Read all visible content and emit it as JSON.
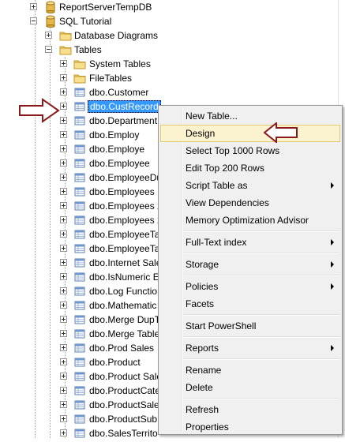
{
  "tree": {
    "nodes": [
      {
        "label": "ReportServerTempDB",
        "icon": "database-icon",
        "expanded": false
      },
      {
        "label": "SQL Tutorial",
        "icon": "database-icon",
        "expanded": true
      },
      {
        "label": "Database Diagrams",
        "icon": "folder-icon",
        "expanded": false
      },
      {
        "label": "Tables",
        "icon": "folder-icon",
        "expanded": true
      },
      {
        "label": "System Tables",
        "icon": "folder-icon",
        "expanded": false
      },
      {
        "label": "FileTables",
        "icon": "folder-icon",
        "expanded": false
      },
      {
        "label": "dbo.Customer",
        "icon": "table-icon",
        "expanded": false
      },
      {
        "label": "dbo.CustRecord",
        "icon": "table-icon",
        "expanded": false,
        "selected": true
      },
      {
        "label": "dbo.Department",
        "icon": "table-icon",
        "expanded": false
      },
      {
        "label": "dbo.Employ",
        "icon": "table-icon",
        "expanded": false
      },
      {
        "label": "dbo.Employe",
        "icon": "table-icon",
        "expanded": false
      },
      {
        "label": "dbo.Employee",
        "icon": "table-icon",
        "expanded": false
      },
      {
        "label": "dbo.EmployeeDu",
        "icon": "table-icon",
        "expanded": false
      },
      {
        "label": "dbo.Employees",
        "icon": "table-icon",
        "expanded": false
      },
      {
        "label": "dbo.Employees 2",
        "icon": "table-icon",
        "expanded": false
      },
      {
        "label": "dbo.Employees 2",
        "icon": "table-icon",
        "expanded": false
      },
      {
        "label": "dbo.EmployeeTa",
        "icon": "table-icon",
        "expanded": false
      },
      {
        "label": "dbo.EmployeeTa",
        "icon": "table-icon",
        "expanded": false
      },
      {
        "label": "dbo.Internet Sale",
        "icon": "table-icon",
        "expanded": false
      },
      {
        "label": "dbo.IsNumeric E",
        "icon": "table-icon",
        "expanded": false
      },
      {
        "label": "dbo.Log Functio",
        "icon": "table-icon",
        "expanded": false
      },
      {
        "label": "dbo.Mathematic",
        "icon": "table-icon",
        "expanded": false
      },
      {
        "label": "dbo.Merge DupT",
        "icon": "table-icon",
        "expanded": false
      },
      {
        "label": "dbo.Merge Table",
        "icon": "table-icon",
        "expanded": false
      },
      {
        "label": "dbo.Prod Sales",
        "icon": "table-icon",
        "expanded": false
      },
      {
        "label": "dbo.Product",
        "icon": "table-icon",
        "expanded": false
      },
      {
        "label": "dbo.Product Sale",
        "icon": "table-icon",
        "expanded": false
      },
      {
        "label": "dbo.ProductCate",
        "icon": "table-icon",
        "expanded": false
      },
      {
        "label": "dbo.ProductSale",
        "icon": "table-icon",
        "expanded": false
      },
      {
        "label": "dbo.ProductSub",
        "icon": "table-icon",
        "expanded": false
      },
      {
        "label": "dbo.SalesTerrito",
        "icon": "table-icon",
        "expanded": false
      }
    ]
  },
  "context_menu": {
    "items": [
      {
        "label": "New Table...",
        "submenu": false
      },
      {
        "label": "Design",
        "submenu": false,
        "highlighted": true
      },
      {
        "label": "Select Top 1000 Rows",
        "submenu": false
      },
      {
        "label": "Edit Top 200 Rows",
        "submenu": false
      },
      {
        "label": "Script Table as",
        "submenu": true
      },
      {
        "label": "View Dependencies",
        "submenu": false
      },
      {
        "label": "Memory Optimization Advisor",
        "submenu": false
      },
      {
        "separator": true
      },
      {
        "label": "Full-Text index",
        "submenu": true
      },
      {
        "separator": true
      },
      {
        "label": "Storage",
        "submenu": true
      },
      {
        "separator": true
      },
      {
        "label": "Policies",
        "submenu": true
      },
      {
        "label": "Facets",
        "submenu": false
      },
      {
        "separator": true
      },
      {
        "label": "Start PowerShell",
        "submenu": false
      },
      {
        "separator": true
      },
      {
        "label": "Reports",
        "submenu": true
      },
      {
        "separator": true
      },
      {
        "label": "Rename",
        "submenu": false
      },
      {
        "label": "Delete",
        "submenu": false
      },
      {
        "separator": true
      },
      {
        "label": "Refresh",
        "submenu": false
      },
      {
        "label": "Properties",
        "submenu": false
      }
    ]
  },
  "annotations": {
    "arrow_color": "#8b1a1a"
  },
  "colors": {
    "selection": "#3399ff",
    "menu_highlight": "#fbf3cf",
    "menu_highlight_border": "#e4c76e",
    "menu_bg": "#f0f0f0"
  }
}
